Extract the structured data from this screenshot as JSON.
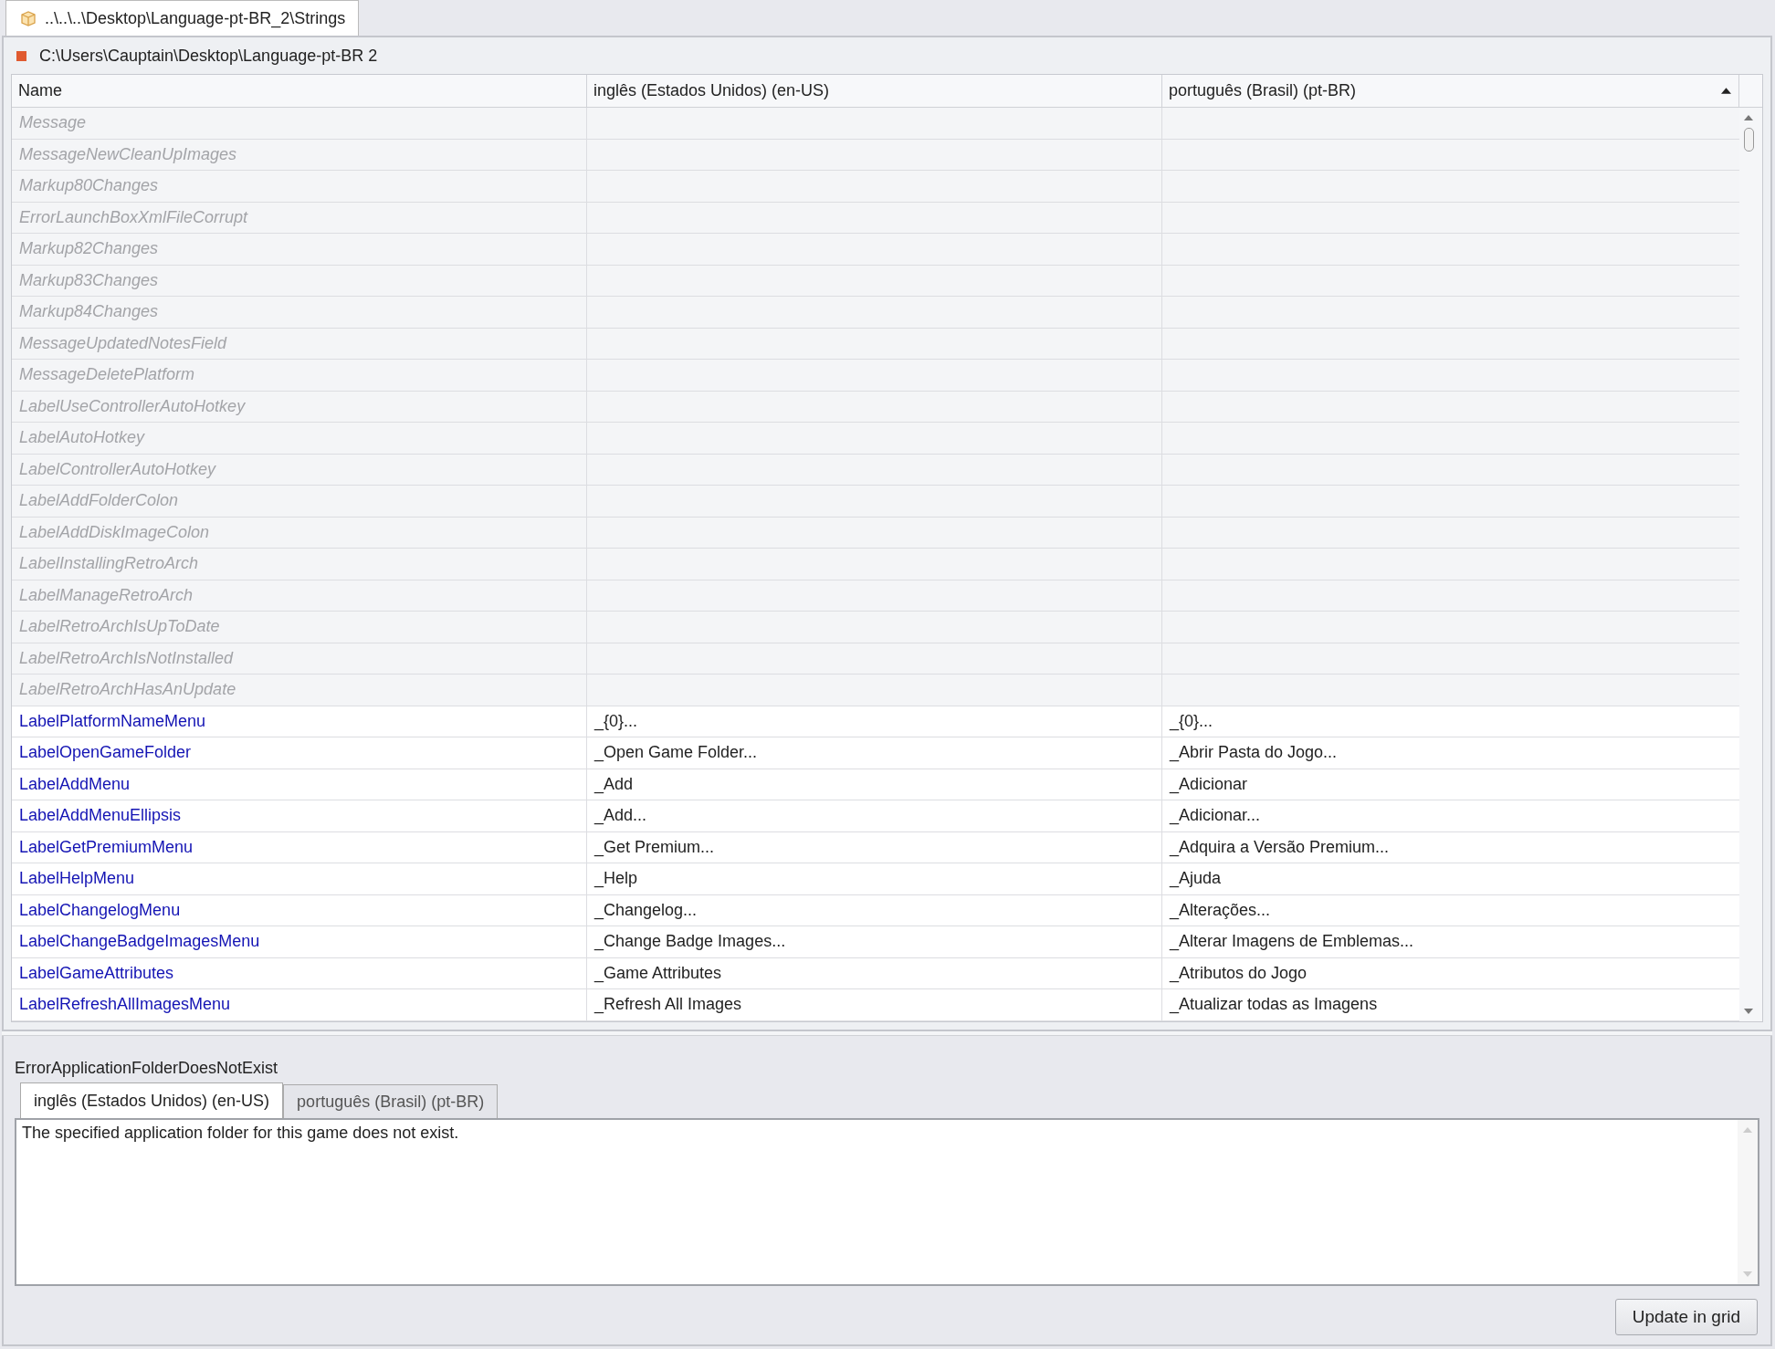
{
  "document_tab": {
    "title": "..\\..\\..\\Desktop\\Language-pt-BR_2\\Strings",
    "selected": true
  },
  "path_bar": {
    "path": "C:\\Users\\Cauptain\\Desktop\\Language-pt-BR 2"
  },
  "table": {
    "columns": [
      {
        "label": "Name",
        "sorted": false
      },
      {
        "label": "inglês (Estados Unidos) (en-US)",
        "sorted": false
      },
      {
        "label": "português (Brasil) (pt-BR)",
        "sorted": true
      }
    ],
    "rows": [
      {
        "name": "Message",
        "en": "",
        "pt": "",
        "disabled": true
      },
      {
        "name": "MessageNewCleanUpImages",
        "en": "",
        "pt": "",
        "disabled": true
      },
      {
        "name": "Markup80Changes",
        "en": "",
        "pt": "",
        "disabled": true
      },
      {
        "name": "ErrorLaunchBoxXmlFileCorrupt",
        "en": "",
        "pt": "",
        "disabled": true
      },
      {
        "name": "Markup82Changes",
        "en": "",
        "pt": "",
        "disabled": true
      },
      {
        "name": "Markup83Changes",
        "en": "",
        "pt": "",
        "disabled": true
      },
      {
        "name": "Markup84Changes",
        "en": "",
        "pt": "",
        "disabled": true
      },
      {
        "name": "MessageUpdatedNotesField",
        "en": "",
        "pt": "",
        "disabled": true
      },
      {
        "name": "MessageDeletePlatform",
        "en": "",
        "pt": "",
        "disabled": true
      },
      {
        "name": "LabelUseControllerAutoHotkey",
        "en": "",
        "pt": "",
        "disabled": true
      },
      {
        "name": "LabelAutoHotkey",
        "en": "",
        "pt": "",
        "disabled": true
      },
      {
        "name": "LabelControllerAutoHotkey",
        "en": "",
        "pt": "",
        "disabled": true
      },
      {
        "name": "LabelAddFolderColon",
        "en": "",
        "pt": "",
        "disabled": true
      },
      {
        "name": "LabelAddDiskImageColon",
        "en": "",
        "pt": "",
        "disabled": true
      },
      {
        "name": "LabelInstallingRetroArch",
        "en": "",
        "pt": "",
        "disabled": true
      },
      {
        "name": "LabelManageRetroArch",
        "en": "",
        "pt": "",
        "disabled": true
      },
      {
        "name": "LabelRetroArchIsUpToDate",
        "en": "",
        "pt": "",
        "disabled": true
      },
      {
        "name": "LabelRetroArchIsNotInstalled",
        "en": "",
        "pt": "",
        "disabled": true
      },
      {
        "name": "LabelRetroArchHasAnUpdate",
        "en": "",
        "pt": "",
        "disabled": true
      },
      {
        "name": "LabelPlatformNameMenu",
        "en": "_{0}...",
        "pt": "_{0}...",
        "disabled": false
      },
      {
        "name": "LabelOpenGameFolder",
        "en": "_Open Game Folder...",
        "pt": "_Abrir Pasta do Jogo...",
        "disabled": false
      },
      {
        "name": "LabelAddMenu",
        "en": "_Add",
        "pt": "_Adicionar",
        "disabled": false
      },
      {
        "name": "LabelAddMenuEllipsis",
        "en": "_Add...",
        "pt": "_Adicionar...",
        "disabled": false
      },
      {
        "name": "LabelGetPremiumMenu",
        "en": "_Get Premium...",
        "pt": "_Adquira a Versão Premium...",
        "disabled": false
      },
      {
        "name": "LabelHelpMenu",
        "en": "_Help",
        "pt": "_Ajuda",
        "disabled": false
      },
      {
        "name": "LabelChangelogMenu",
        "en": "_Changelog...",
        "pt": "_Alterações...",
        "disabled": false
      },
      {
        "name": "LabelChangeBadgeImagesMenu",
        "en": "_Change Badge Images...",
        "pt": "_Alterar Imagens de Emblemas...",
        "disabled": false
      },
      {
        "name": "LabelGameAttributes",
        "en": "_Game Attributes",
        "pt": "_Atributos do Jogo",
        "disabled": false
      },
      {
        "name": "LabelRefreshAllImagesMenu",
        "en": "_Refresh All Images",
        "pt": "_Atualizar todas as Imagens",
        "disabled": false
      }
    ]
  },
  "editor": {
    "key": "ErrorApplicationFolderDoesNotExist",
    "tabs": [
      {
        "label": "inglês (Estados Unidos) (en-US)",
        "selected": true
      },
      {
        "label": "português (Brasil) (pt-BR)",
        "selected": false
      }
    ],
    "value": "The specified application folder for this game does not exist.",
    "button": "Update in grid"
  }
}
